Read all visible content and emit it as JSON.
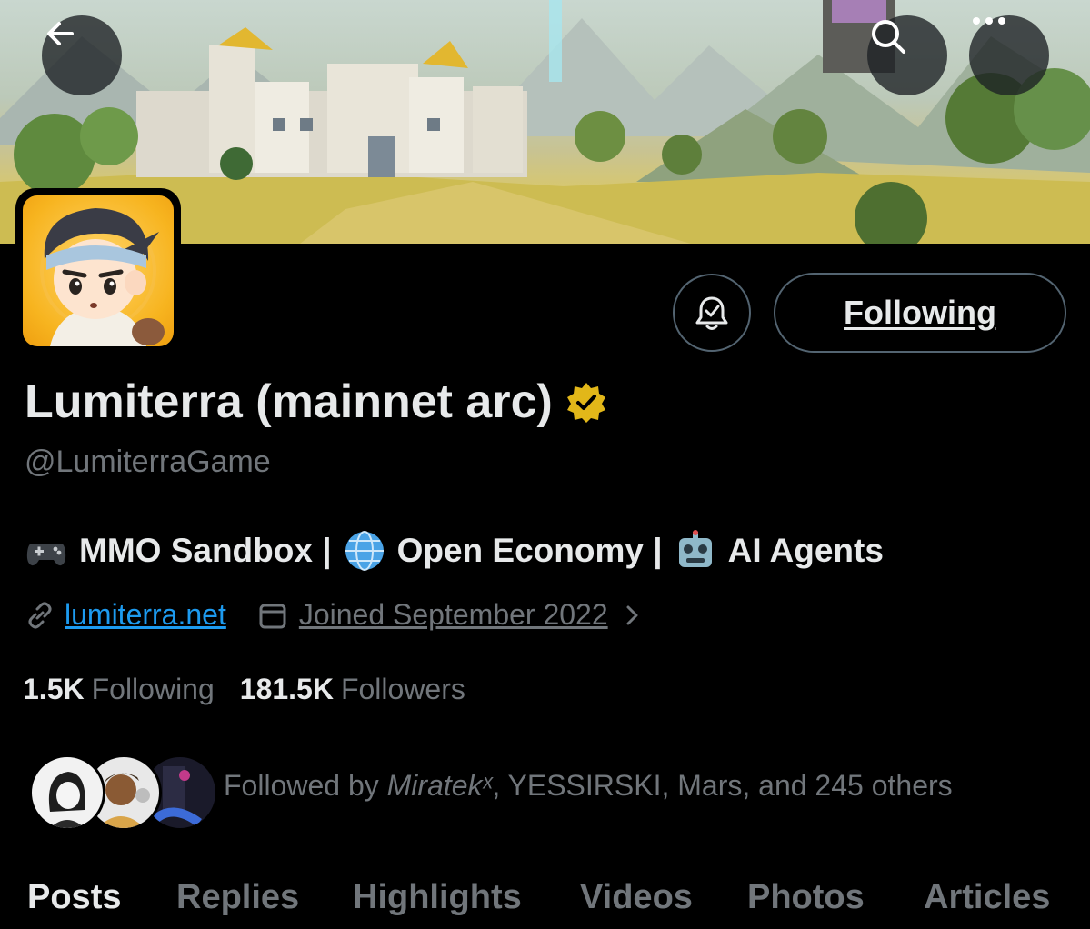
{
  "header": {
    "back_icon": "arrow-left-icon",
    "search_icon": "search-icon",
    "more_icon": "more-horizontal-icon"
  },
  "profile": {
    "display_name": "Lumiterra (mainnet arc)",
    "verified_color": "#e2b719",
    "handle": "@LumiterraGame",
    "bio": [
      {
        "icon": "game-controller-icon",
        "text": "MMO Sandbox |"
      },
      {
        "icon": "globe-icon",
        "text": "Open Economy |"
      },
      {
        "icon": "robot-icon",
        "text": "AI Agents"
      }
    ],
    "website": "lumiterra.net",
    "joined": "Joined September 2022",
    "following_count": "1.5K",
    "following_label": "Following",
    "followers_count": "181.5K",
    "followers_label": "Followers"
  },
  "actions": {
    "notify_icon": "bell-check-icon",
    "following_button": "Following"
  },
  "followed_by": {
    "prefix": "Followed by ",
    "name1": "Miratekˣ",
    "rest": ", YESSIRSKI, Mars, and 245 others"
  },
  "tabs": [
    "Posts",
    "Replies",
    "Highlights",
    "Videos",
    "Photos",
    "Articles"
  ],
  "colors": {
    "accent": "#1d9bf0",
    "muted": "#71767b",
    "text": "#e7e9ea",
    "background": "#000000"
  }
}
